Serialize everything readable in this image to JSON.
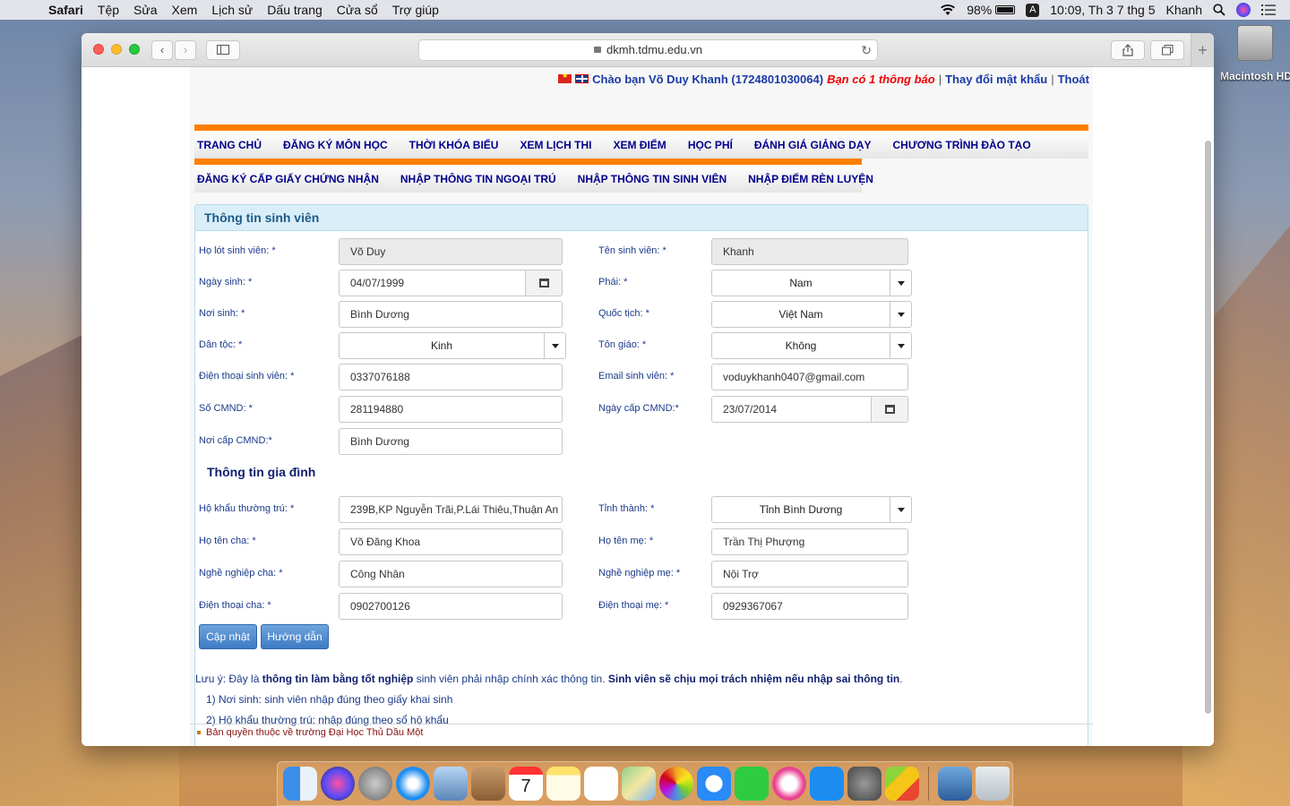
{
  "menubar": {
    "app": "Safari",
    "items": [
      "Tệp",
      "Sửa",
      "Xem",
      "Lịch sử",
      "Dấu trang",
      "Cửa sổ",
      "Trợ giúp"
    ],
    "battery": "98%",
    "battery_level": 0.98,
    "input_source": "A",
    "clock": "10:09, Th 3 7 thg 5",
    "user": "Khanh"
  },
  "desktop": {
    "disk_label": "Macintosh HD"
  },
  "browser": {
    "url": "dkmh.tdmu.edu.vn"
  },
  "header": {
    "greeting": "Chào bạn Võ Duy Khanh (1724801030064)",
    "notify": "Bạn có 1 thông báo",
    "change_password": "Thay đổi mật khẩu",
    "logout": "Thoát"
  },
  "nav": {
    "row1": [
      "TRANG CHỦ",
      "ĐĂNG KÝ MÔN HỌC",
      "THỜI KHÓA BIỂU",
      "XEM LỊCH THI",
      "XEM ĐIỂM",
      "HỌC PHÍ",
      "ĐÁNH GIÁ GIẢNG DẠY",
      "CHƯƠNG TRÌNH ĐÀO TẠO"
    ],
    "row2": [
      "ĐĂNG KÝ CẤP GIẤY CHỨNG NHẬN",
      "NHẬP THÔNG TIN NGOẠI TRÚ",
      "NHẬP THÔNG TIN SINH VIÊN",
      "NHẬP ĐIỂM RÈN LUYỆN"
    ]
  },
  "panel": {
    "title": "Thông tin sinh viên",
    "family_title": "Thông tin gia đình"
  },
  "student": {
    "ho_lot": {
      "label": "Họ lót sinh viên: *",
      "value": "Võ Duy"
    },
    "ten": {
      "label": "Tên sinh viên: *",
      "value": "Khanh"
    },
    "ngay_sinh": {
      "label": "Ngày sinh: *",
      "value": "04/07/1999"
    },
    "phai": {
      "label": "Phái: *",
      "value": "Nam"
    },
    "noi_sinh": {
      "label": "Nơi sinh: *",
      "value": "Bình Dương"
    },
    "quoc_tich": {
      "label": "Quốc tịch: *",
      "value": "Việt Nam"
    },
    "dan_toc": {
      "label": "Dân tộc: *",
      "value": "Kinh"
    },
    "ton_giao": {
      "label": "Tôn giáo: *",
      "value": "Không"
    },
    "dien_thoai": {
      "label": "Điện thoại sinh viên: *",
      "value": "0337076188"
    },
    "email": {
      "label": "Email sinh viên: *",
      "value": "voduykhanh0407@gmail.com"
    },
    "so_cmnd": {
      "label": "Số CMND: *",
      "value": "281194880"
    },
    "ngay_cap": {
      "label": "Ngày cấp CMND:*",
      "value": "23/07/2014"
    },
    "noi_cap": {
      "label": "Nơi cấp CMND:*",
      "value": "Bình Dương"
    }
  },
  "family": {
    "ho_khau": {
      "label": "Hộ khẩu thường trú: *",
      "value": "239B,KP Nguyễn Trãi,P.Lái Thiêu,Thuận An"
    },
    "tinh_thanh": {
      "label": "Tỉnh thành: *",
      "value": "Tỉnh Bình Dương"
    },
    "ten_cha": {
      "label": "Họ tên cha: *",
      "value": "Võ Đăng Khoa"
    },
    "ten_me": {
      "label": "Họ tên mẹ: *",
      "value": "Trần Thị Phượng"
    },
    "nghe_cha": {
      "label": "Nghề nghiệp cha: *",
      "value": "Công Nhân"
    },
    "nghe_me": {
      "label": "Nghề nghiệp mẹ: *",
      "value": "Nội Trợ"
    },
    "dt_cha": {
      "label": "Điện thoại cha: *",
      "value": "0902700126"
    },
    "dt_me": {
      "label": "Điện thoại mẹ: *",
      "value": "0929367067"
    }
  },
  "buttons": {
    "update": "Cập nhật",
    "guide": "Hướng dẫn"
  },
  "note": {
    "prefix": "Lưu ý: Đây là ",
    "bold1": "thông tin làm bằng tốt nghiệp",
    "mid": " sinh viên phải nhập chính xác thông tin. ",
    "bold2": "Sinh viên sẽ chịu mọi trách nhiệm nếu nhập sai thông tin",
    "suffix": ".",
    "item1": "1) Nơi sinh: sinh viên nhập đúng theo giấy khai sinh",
    "item2": "2) Hộ khẩu thường trú: nhập đúng theo sổ hộ khẩu"
  },
  "footer": "Bản quyền thuộc về trường Đại Học Thủ Dầu Một",
  "dock": {
    "calendar_month": "THG 5",
    "calendar_day": "7",
    "apps": [
      "finder-icon",
      "siri-icon",
      "launchpad-icon",
      "safari-icon",
      "mail-icon",
      "contacts-icon",
      "calendar-icon",
      "notes-icon",
      "reminders-icon",
      "maps-icon",
      "photos-icon",
      "messages-icon",
      "facetime-icon",
      "itunes-icon",
      "app-store-icon",
      "system-preferences-icon",
      "bluestacks-icon",
      "screen-sharing-icon",
      "trash-icon"
    ]
  },
  "colors": {
    "nav_accent": "#ff8000",
    "nav_text": "#00008b",
    "panel_head_bg": "#d9eef8",
    "button_bg": "#3d7bc4",
    "notify_red": "#e00000"
  }
}
